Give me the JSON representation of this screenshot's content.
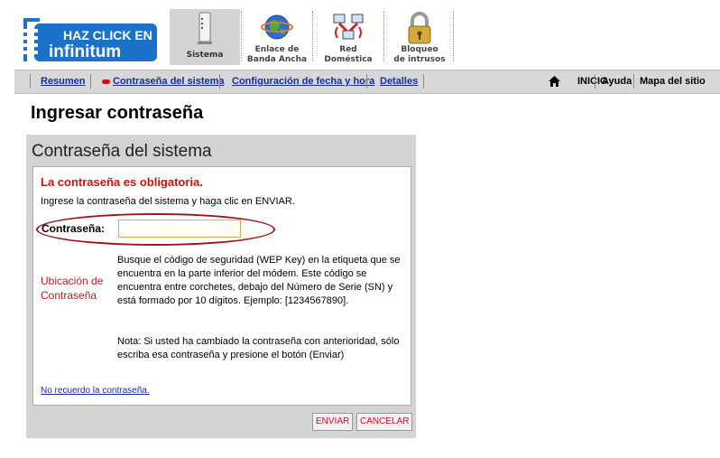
{
  "logo": {
    "line1": "HAZ CLICK EN",
    "line2": "infinitum",
    "colors": {
      "bg": "#1b73c9",
      "text": "#ffffff"
    }
  },
  "tabs": [
    {
      "label": "Sistema",
      "icon": "modem-icon",
      "active": true
    },
    {
      "label": "Enlace de\nBanda Ancha",
      "icon": "globe-icon",
      "active": false
    },
    {
      "label": "Red\nDoméstica",
      "icon": "network-icon",
      "active": false
    },
    {
      "label": "Bloqueo\nde intrusos",
      "icon": "padlock-icon",
      "active": false
    }
  ],
  "nav": {
    "links": [
      "Resumen",
      "Contraseña del sistema",
      "Configuración de fecha y hora",
      "Detalles"
    ],
    "right": {
      "home": "INICIO",
      "help": "Ayuda",
      "sitemap": "Mapa del sitio"
    }
  },
  "page": {
    "title": "Ingresar contraseña"
  },
  "panel": {
    "title": "Contraseña del sistema",
    "required": "La contraseña es obligatoria.",
    "instruction": "Ingrese la contraseña del sistema y haga clic en ENVIAR.",
    "password_label": "Contraseña:",
    "password_value": "",
    "location_label": "Ubicación de Contraseña",
    "location_text": "Busque el código de seguridad (WEP Key) en la etiqueta que se encuentra en la parte inferior del módem. Este código se encuentra entre corchetes, debajo del Número de Serie (SN) y está formado por 10 dígitos. Ejemplo: [1234567890].",
    "note_text": "Nota: Si usted ha cambiado la contraseña con anterioridad, sólo escriba esa contraseña y presione el botón (Enviar)",
    "forgot_link": "No recuerdo la contraseña."
  },
  "buttons": {
    "submit": "ENVIAR",
    "cancel": "CANCELAR"
  },
  "colors": {
    "link": "#1a2b9a",
    "error": "#cc1111",
    "panel_bg": "#d3d3d3",
    "highlight_ellipse": "#a0131b"
  }
}
